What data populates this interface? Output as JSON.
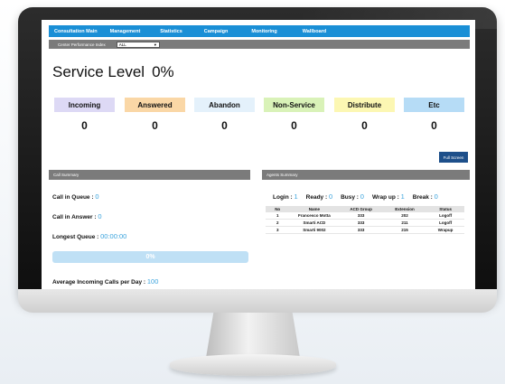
{
  "nav": {
    "items": [
      "Consultation Main",
      "Management",
      "Statistics",
      "Campaign",
      "Monitoring",
      "Wallboard"
    ]
  },
  "filter": {
    "label": "Center Performance Index",
    "selected": "ALL"
  },
  "service": {
    "label": "Service Level",
    "value": "0%"
  },
  "categories": [
    {
      "label": "Incoming",
      "value": "0",
      "color": "#ddd9f5"
    },
    {
      "label": "Answered",
      "value": "0",
      "color": "#fad7a6"
    },
    {
      "label": "Abandon",
      "value": "0",
      "color": "#e4f1fb"
    },
    {
      "label": "Non-Service",
      "value": "0",
      "color": "#d9f2b8"
    },
    {
      "label": "Distribute",
      "value": "0",
      "color": "#fcf7b3"
    },
    {
      "label": "Etc",
      "value": "0",
      "color": "#b6dcf6"
    }
  ],
  "fullscreen_label": "Full Screen",
  "call_summary": {
    "header": "Call Summary",
    "queue_label": "Call in Queue : ",
    "queue_value": "0",
    "answer_label": "Call in Answer : ",
    "answer_value": "0",
    "longest_label": "Longest Queue : ",
    "longest_value": "00:00:00",
    "progress_text": "0%",
    "progress_fraction": 0,
    "avg_label": "Average Incoming Calls per Day : ",
    "avg_value": "100"
  },
  "agents_summary": {
    "header": "Agents Summary",
    "login_label": "Login : ",
    "login_value": "1",
    "ready_label": "Ready : ",
    "ready_value": "0",
    "busy_label": "Busy : ",
    "busy_value": "0",
    "wrapup_label": "Wrap up : ",
    "wrapup_value": "1",
    "break_label": "Break : ",
    "break_value": "0",
    "columns": [
      "No",
      "Name",
      "ACD Group",
      "Extension",
      "Status"
    ],
    "rows": [
      [
        "1",
        "Francesco Motta",
        "333",
        "202",
        "Logoff"
      ],
      [
        "2",
        "Smarti ACD",
        "333",
        "211",
        "Logoff"
      ],
      [
        "3",
        "Smarti 9002",
        "333",
        "215",
        "Wrapup"
      ]
    ]
  },
  "colors": {
    "nav": "#1a8fd6",
    "header_gray": "#7b7b7b",
    "value_blue": "#3aa3dd",
    "fullscreen": "#1d4f8a"
  }
}
